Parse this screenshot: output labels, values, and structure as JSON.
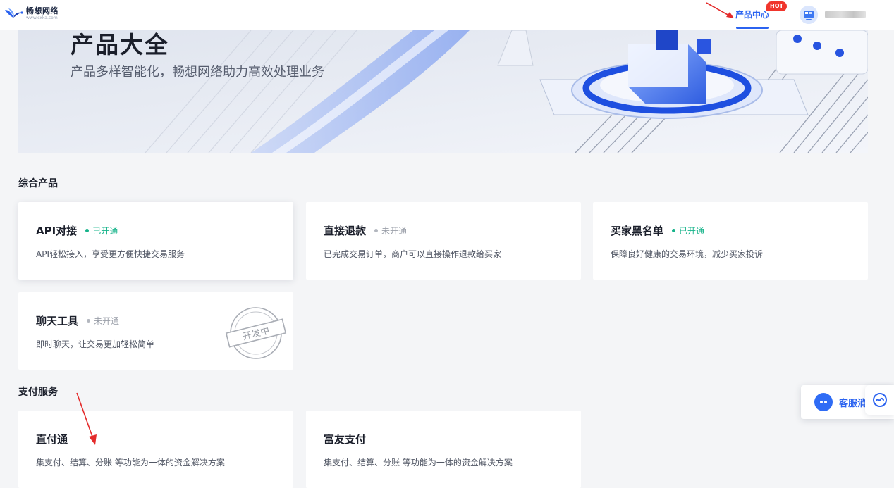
{
  "header": {
    "brand_name": "畅想网络",
    "brand_url": "www.cxka.com",
    "nav_product_center": "产品中心",
    "hot_badge": "HOT",
    "accent_color": "#2b63f0"
  },
  "banner": {
    "title": "产品大全",
    "subtitle": "产品多样智能化，畅想网络助力高效处理业务"
  },
  "sections": {
    "integrated": {
      "title": "综合产品",
      "cards": [
        {
          "name": "API对接",
          "status": "已开通",
          "desc": "API轻松接入，享受更方便快捷交易服务"
        },
        {
          "name": "直接退款",
          "status": "未开通",
          "desc": "已完成交易订单，商户可以直接操作退款给买家"
        },
        {
          "name": "买家黑名单",
          "status": "已开通",
          "desc": "保障良好健康的交易环境，减少买家投诉"
        },
        {
          "name": "聊天工具",
          "status": "未开通",
          "desc": "即时聊天，让交易更加轻松简单",
          "stamp": "开发中"
        }
      ]
    },
    "payment": {
      "title": "支付服务",
      "cards": [
        {
          "name": "直付通",
          "desc": "集支付、结算、分账 等功能为一体的资金解决方案"
        },
        {
          "name": "富友支付",
          "desc": "集支付、结算、分账 等功能为一体的资金解决方案"
        }
      ]
    }
  },
  "floating": {
    "customer_service": "客服消息"
  },
  "icons": [
    "logo-bird-icon",
    "user-avatar-icon",
    "chat-bubble-icon",
    "assistant-icon",
    "dev-stamp-icon"
  ]
}
